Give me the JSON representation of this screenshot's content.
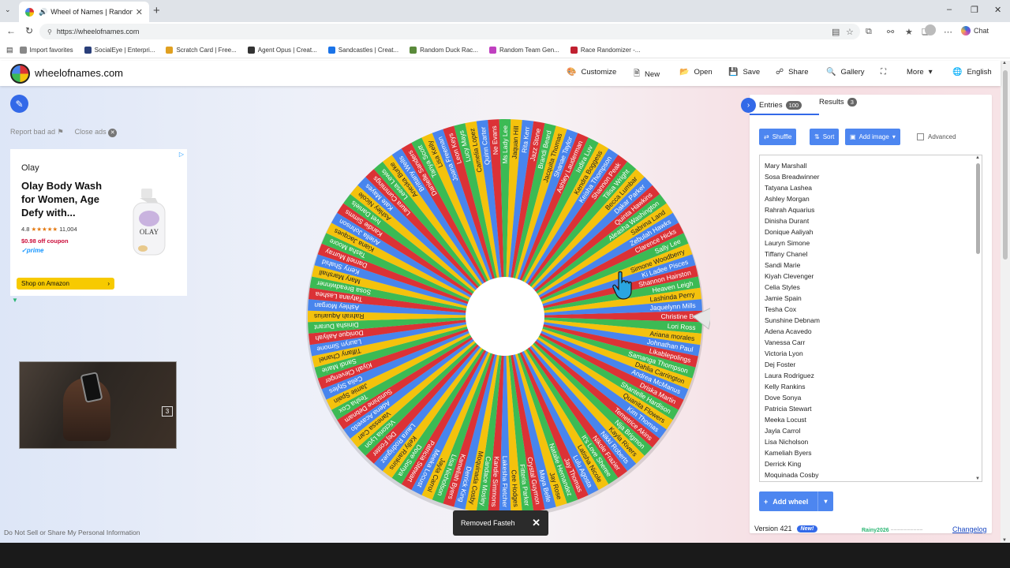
{
  "browser": {
    "tab_title": "Wheel of Names | Random na",
    "url": "https://wheelofnames.com",
    "chat_label": "Chat",
    "bookmarks": [
      {
        "label": "Import favorites",
        "color": "#888888"
      },
      {
        "label": "SocialEye | Enterpri...",
        "color": "#2a3f7a"
      },
      {
        "label": "Scratch Card | Free...",
        "color": "#e0a020"
      },
      {
        "label": "Agent Opus | Creat...",
        "color": "#333333"
      },
      {
        "label": "Sandcastles | Creat...",
        "color": "#1a73e8"
      },
      {
        "label": "Random Duck Rac...",
        "color": "#5a8a3a"
      },
      {
        "label": "Random Team Gen...",
        "color": "#c040c0"
      },
      {
        "label": "Race Randomizer -...",
        "color": "#c02030"
      }
    ]
  },
  "header": {
    "site_name": "wheelofnames.com",
    "menu": [
      {
        "label": "Customize",
        "icon": "palette-icon"
      },
      {
        "label": "New",
        "icon": "file-icon"
      },
      {
        "label": "Open",
        "icon": "folder-icon"
      },
      {
        "label": "Save",
        "icon": "save-icon"
      },
      {
        "label": "Share",
        "icon": "share-icon"
      },
      {
        "label": "Gallery",
        "icon": "search-icon"
      },
      {
        "label": "",
        "icon": "fullscreen-icon"
      },
      {
        "label": "More",
        "icon": "chevron-down-icon"
      },
      {
        "label": "English",
        "icon": "globe-icon"
      }
    ]
  },
  "left": {
    "report_ad": "Report bad ad",
    "close_ads": "Close ads",
    "ad": {
      "brand": "Olay",
      "headline": "Olay Body Wash for Women, Age Defy with...",
      "rating": "4.8",
      "reviews": "11,004",
      "coupon": "$0.98 off coupon",
      "prime": "prime",
      "cta": "Shop on Amazon",
      "bottle_label": "OLAY"
    },
    "video_count": "3",
    "footer_link": "Do Not Sell or Share My Personal Information"
  },
  "toast": {
    "text": "Removed Fasteh"
  },
  "panel": {
    "tabs": {
      "entries_label": "Entries",
      "entries_count": "100",
      "results_label": "Results",
      "results_count": "3"
    },
    "shuffle": "Shuffle",
    "sort": "Sort",
    "add_image": "Add image",
    "advanced": "Advanced",
    "entries": [
      "Mary Marshall",
      "Sosa Breadwinner",
      "Tatyana Lashea",
      "Ashley Morgan",
      "Rahrah Aquarius",
      "Dinisha Durant",
      "Donique Aaliyah",
      "Lauryn Simone",
      "Tiffany Chanel",
      "Sandi Marie",
      "Kiyah Clevenger",
      "Celia Styles",
      "Jamie Spain",
      "Tesha Cox",
      "Sunshine Debnam",
      "Adena Acavedo",
      "Vanessa Carr",
      "Victoria Lyon",
      "Dej Foster",
      "Laura Rodriguez",
      "Kelly Rankins",
      "Dove Sonya",
      "Patricia Stewart",
      "Meeka Locust",
      "Jayla Carrol",
      "Lisa Nicholson",
      "Kameliah Byers",
      "Derrick King",
      "Moquinada Cosby"
    ],
    "add_wheel": "Add wheel",
    "version": "Version 421",
    "new_badge": "New!",
    "signature": "Rainy2026",
    "changelog": "Changelog"
  },
  "wheel": {
    "colors": [
      "#db3236",
      "#3cba54",
      "#f4c20d",
      "#4885ed"
    ],
    "names": [
      "Christine Br",
      "Lori Ross",
      "Ariana morales",
      "Johnathan Paul",
      "Likablepolings",
      "Samanga Thompson",
      "Dahlia Carrington",
      "Andrea McManus",
      "Driska Martin",
      "Shantelle Hardison",
      "Quanita Flowers",
      "Kim Thomas",
      "Temetrice Akins",
      "Nija Brigmon",
      "Kayla Rivers",
      "Nikki Roberts",
      "Nikole Frazier",
      "It's Love Sheree",
      "Latisha Nicole",
      "Lulu Agosta",
      "Jay Thomas",
      "Natalie Hernandez",
      "Jay Rose",
      "Maya Belle",
      "Crystal Guymon",
      "Fitteria Parker",
      "Cee Hodges",
      "Lakesha Fletcher",
      "Kandie Simmons",
      "Candace Mosley",
      "Moquinada Cosby",
      "Derrick King",
      "Kameliah Byers",
      "Lisa Nicholson",
      "Jayla Carrol",
      "Meeka Locust",
      "Patricia Stewart",
      "Dove Sonya",
      "Kelly Rankins",
      "Laura Rodriguez",
      "Dej Foster",
      "Victoria Lyon",
      "Vanessa Carr",
      "Adena Acavedo",
      "Sunshine Debnam",
      "Tesha Cox",
      "Jamie Spain",
      "Celia Styles",
      "Kiyah Clevenger",
      "Sandi Marie",
      "Tiffany Chanel",
      "Lauryn Simone",
      "Donique Aaliyah",
      "Dinisha Durant",
      "Rahrah Aquarius",
      "Ashley Morgan",
      "Tatyana Lashea",
      "Sosa Breadwinner",
      "Mary Marshall",
      "Kerry Shahid",
      "Darnell Murray",
      "Tasha Moore",
      "Kiana Jacques",
      "Ariella Johnson",
      "Kandie Simms",
      "Ivet Daniels",
      "Ashley Nicole",
      "Kate Mayes",
      "Laura Cummings",
      "Leesa Lewis",
      "Aneska Burke",
      "Brittany Wells",
      "Danielle Sanders",
      "Tanya Scott",
      "Lisa Kelly",
      "Joana Freeman",
      "Leon Keys",
      "Lucy Mays",
      "Camelia Lopez",
      "Quinn Carter",
      "Ne Evans",
      "Ms Lady Lee",
      "Jaquan Hill",
      "Rita Kerr",
      "Jazz Stone",
      "Brandi Beard",
      "Jacquita Thomas",
      "Shanae Taylor",
      "Ashley Lauderman",
      "Indira Luv",
      "Kendra Boggess",
      "Keisha Thompson",
      "Shannon Peak",
      "Tilisa Wright",
      "Becca Lumbar",
      "Dakar Parker",
      "Quinta Hawkins",
      "Aleasha Washington",
      "Sabrina Land",
      "Zebulah Hawks",
      "Clarence Hicks",
      "Sally Lee",
      "Simone Woodberry",
      "Ki Ladee Pisces",
      "Shannon Hairston",
      "Heaven Leigh",
      "Lashinda Perry",
      "Jaquelynn Mills"
    ]
  }
}
